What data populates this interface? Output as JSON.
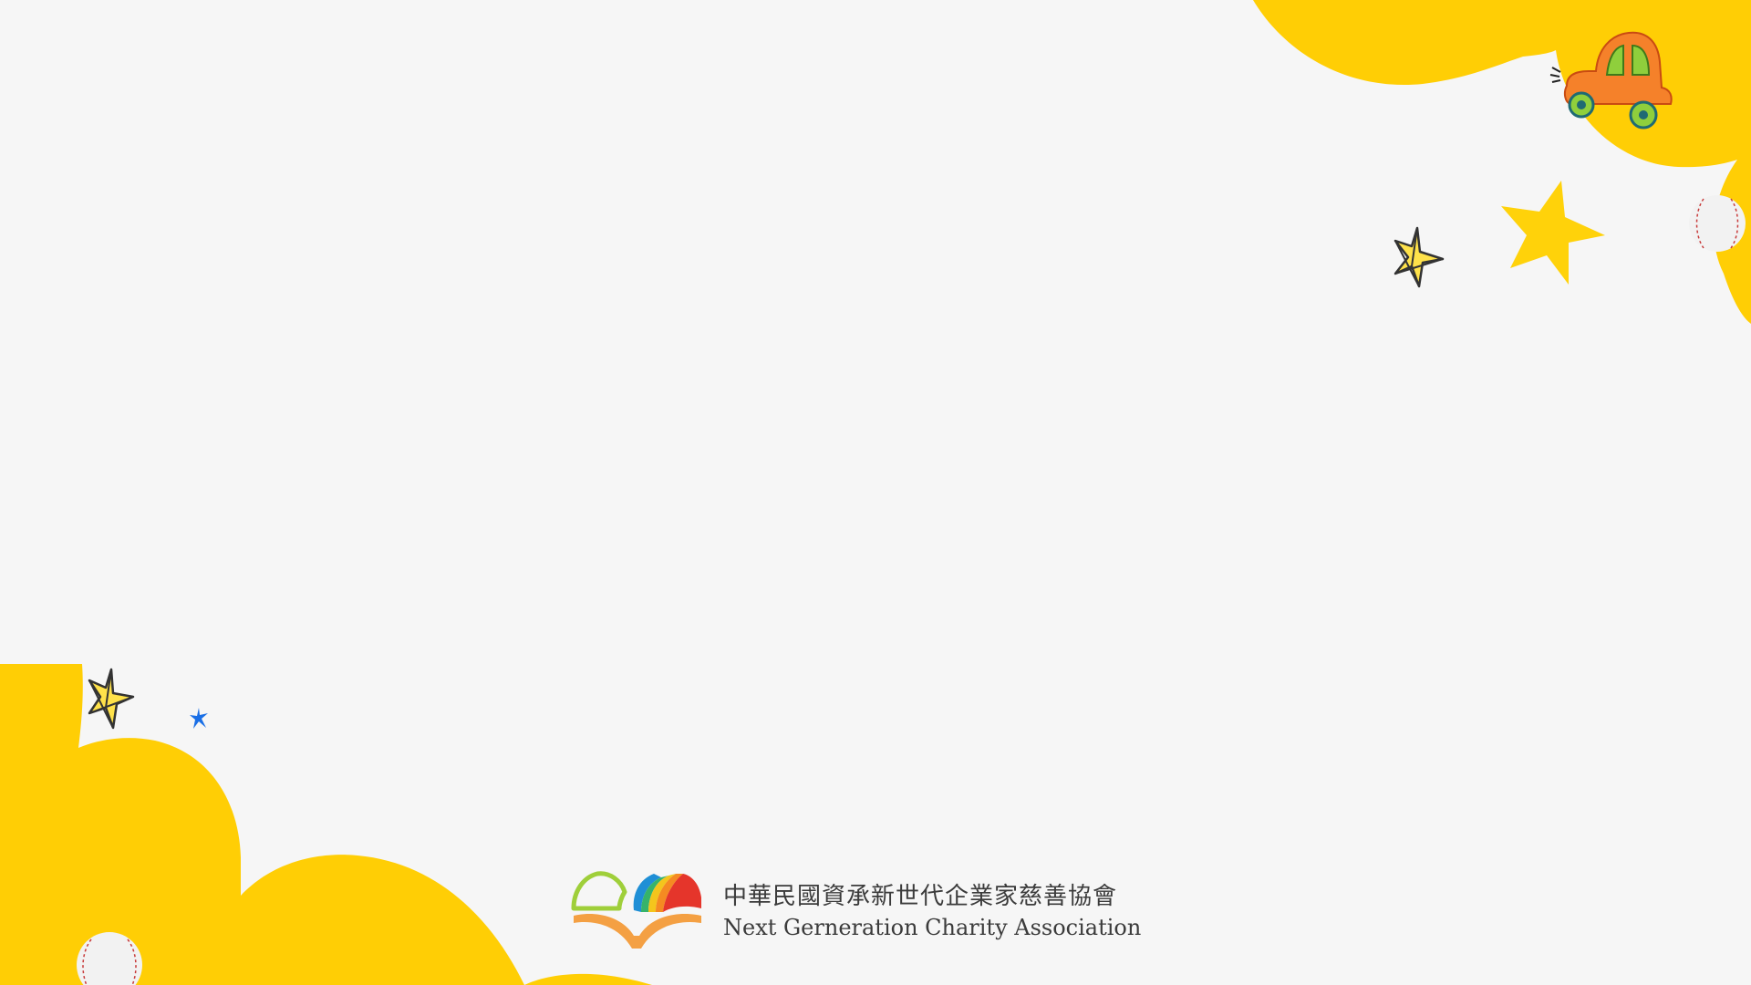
{
  "logo": {
    "name_zh": "中華民國資承新世代企業家慈善協會",
    "name_en": "Next Gerneration Charity Association"
  },
  "colors": {
    "background": "#f6f6f6",
    "cloud_yellow": "#ffce05",
    "star_yellow": "#ffd20a",
    "accent_blue": "#1a6fe6",
    "car_orange": "#f5812a",
    "car_green": "#8fcf3c"
  },
  "decorations": {
    "icons": [
      "yellow-cloud-icon",
      "toy-car-icon",
      "star-icon",
      "outlined-star-icon",
      "sparkle-icon",
      "baseball-icon",
      "open-book-rainbow-icon"
    ]
  }
}
